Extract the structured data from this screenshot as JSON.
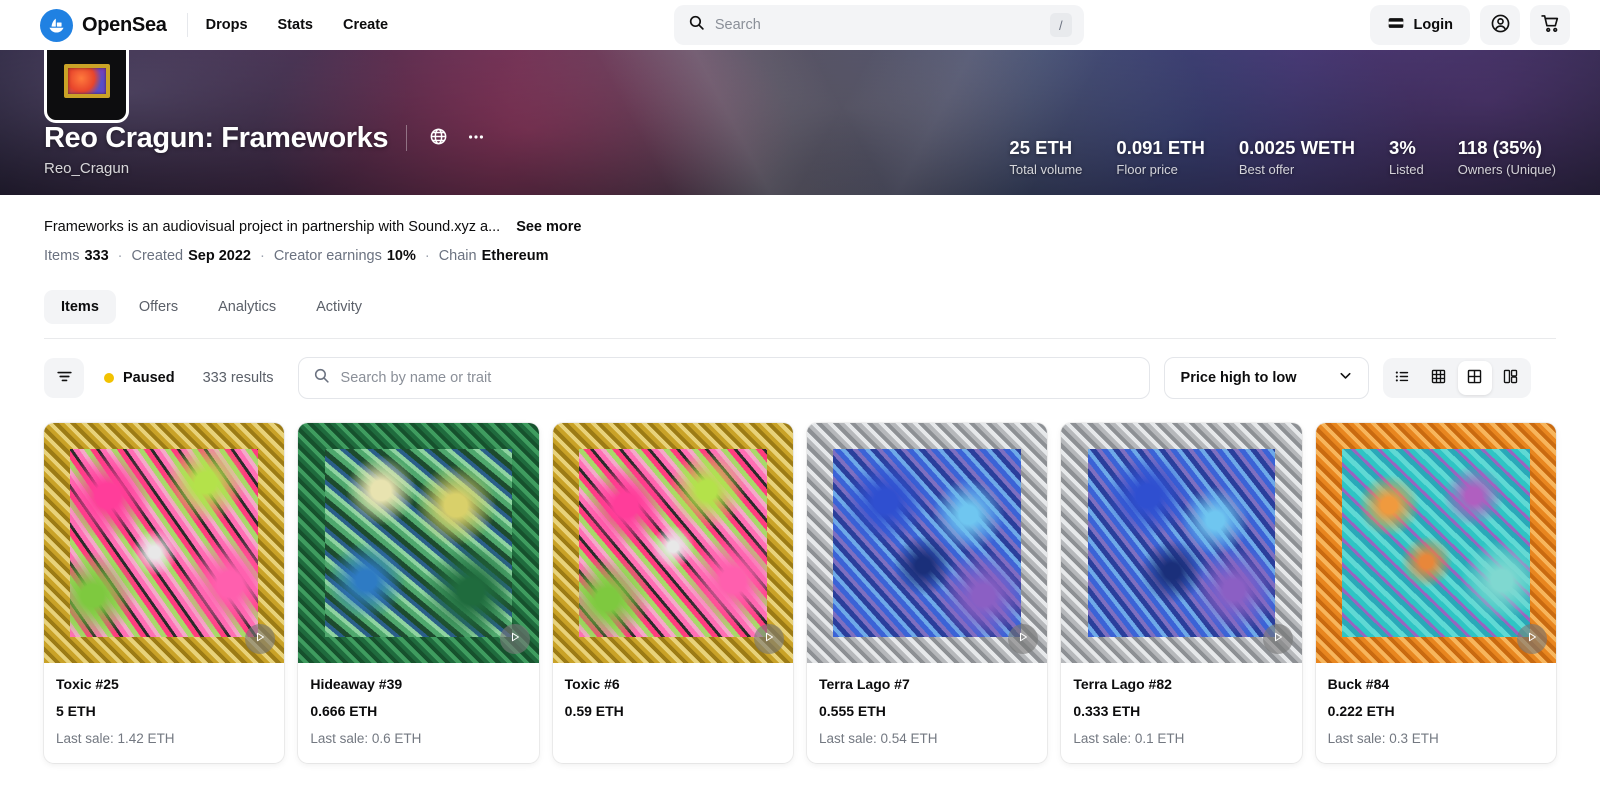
{
  "nav": {
    "brand": "OpenSea",
    "brand_logo_icon": "opensea-boat-logo",
    "links": [
      {
        "label": "Drops"
      },
      {
        "label": "Stats"
      },
      {
        "label": "Create"
      }
    ],
    "search": {
      "placeholder": "Search",
      "value": "",
      "shortcut_key": "/",
      "icon": "search-icon"
    },
    "login_label": "Login",
    "login_icon": "wallet-icon",
    "account_icon": "account-circle-icon",
    "cart_icon": "shopping-cart-icon"
  },
  "banner": {
    "avatar_icon": "collection-avatar",
    "title": "Reo Cragun: Frameworks",
    "creator": "Reo_Cragun",
    "website_icon": "globe-icon",
    "more_icon": "ellipsis-icon",
    "stats": [
      {
        "value": "25 ETH",
        "label": "Total volume"
      },
      {
        "value": "0.091 ETH",
        "label": "Floor price"
      },
      {
        "value": "0.0025 WETH",
        "label": "Best offer"
      },
      {
        "value": "3%",
        "label": "Listed"
      },
      {
        "value": "118 (35%)",
        "label": "Owners (Unique)"
      }
    ]
  },
  "description": {
    "text": "Frameworks is an audiovisual project in partnership with Sound.xyz a...",
    "see_more_label": "See more",
    "meta": {
      "items_label": "Items",
      "items_value": "333",
      "created_label": "Created",
      "created_value": "Sep 2022",
      "earnings_label": "Creator earnings",
      "earnings_value": "10%",
      "chain_label": "Chain",
      "chain_value": "Ethereum"
    }
  },
  "tabs": [
    {
      "label": "Items",
      "active": true
    },
    {
      "label": "Offers",
      "active": false
    },
    {
      "label": "Analytics",
      "active": false
    },
    {
      "label": "Activity",
      "active": false
    }
  ],
  "toolbar": {
    "filter_icon": "filter-icon",
    "status_text": "Paused",
    "status_color": "#f2c200",
    "results_text": "333 results",
    "search": {
      "placeholder": "Search by name or trait",
      "value": "",
      "icon": "search-icon"
    },
    "sort": {
      "selected": "Price high to low",
      "chevron_icon": "chevron-down-icon"
    },
    "views": [
      {
        "icon": "list-view-icon",
        "active": false
      },
      {
        "icon": "small-grid-view-icon",
        "active": false
      },
      {
        "icon": "large-grid-view-icon",
        "active": true
      },
      {
        "icon": "split-view-icon",
        "active": false
      }
    ]
  },
  "items": [
    {
      "name": "Toxic #25",
      "price": "5 ETH",
      "last_sale": "Last sale: 1.42 ETH",
      "frame": "gold",
      "art": "pink",
      "play_icon": "play-icon"
    },
    {
      "name": "Hideaway #39",
      "price": "0.666 ETH",
      "last_sale": "Last sale: 0.6 ETH",
      "frame": "green",
      "art": "green",
      "play_icon": "play-icon"
    },
    {
      "name": "Toxic #6",
      "price": "0.59 ETH",
      "last_sale": "",
      "frame": "gold",
      "art": "pink",
      "play_icon": "play-icon"
    },
    {
      "name": "Terra Lago #7",
      "price": "0.555 ETH",
      "last_sale": "Last sale: 0.54 ETH",
      "frame": "silver",
      "art": "blue",
      "play_icon": "play-icon"
    },
    {
      "name": "Terra Lago #82",
      "price": "0.333 ETH",
      "last_sale": "Last sale: 0.1 ETH",
      "frame": "silver",
      "art": "blue",
      "play_icon": "play-icon"
    },
    {
      "name": "Buck #84",
      "price": "0.222 ETH",
      "last_sale": "Last sale: 0.3 ETH",
      "frame": "orange",
      "art": "cyan",
      "play_icon": "play-icon"
    }
  ]
}
